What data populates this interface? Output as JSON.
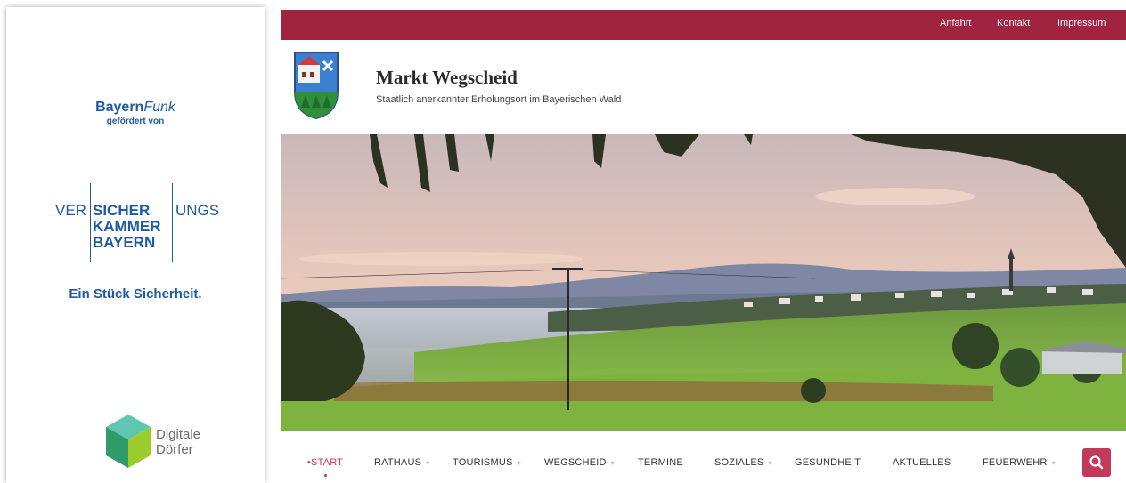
{
  "sponsor": {
    "bayernfunk_main": "Bayern",
    "bayernfunk_italic": "Funk",
    "bayernfunk_sub": "gefördert von",
    "vkb_ver": "VER",
    "vkb_sicher": "SICHER",
    "vkb_ungs": "UNGS",
    "vkb_kammer": "KAMMER",
    "vkb_bayern": "BAYERN",
    "slogan": "Ein Stück Sicherheit.",
    "dd_line1": "Digitale",
    "dd_line2": "Dörfer"
  },
  "topbar": {
    "links": [
      "Anfahrt",
      "Kontakt",
      "Impressum"
    ]
  },
  "header": {
    "title": "Markt Wegscheid",
    "subtitle": "Staatlich anerkannter Erholungsort im Bayerischen Wald"
  },
  "nav": {
    "items": [
      {
        "label": "•START",
        "active": true,
        "dropdown": false
      },
      {
        "label": "RATHAUS",
        "dropdown": true
      },
      {
        "label": "TOURISMUS",
        "dropdown": true
      },
      {
        "label": "WEGSCHEID",
        "dropdown": true
      },
      {
        "label": "TERMINE",
        "dropdown": false
      },
      {
        "label": "SOZIALES",
        "dropdown": true
      },
      {
        "label": "GESUNDHEIT",
        "dropdown": false
      },
      {
        "label": "AKTUELLES",
        "dropdown": false
      },
      {
        "label": "FEUERWEHR",
        "dropdown": true
      }
    ],
    "caret": "▾"
  },
  "colors": {
    "brand": "#a0233f",
    "accent": "#c23a5a",
    "sponsor_blue": "#1f5aa6"
  },
  "icons": {
    "search": "search-icon",
    "crest": "coat-of-arms-icon",
    "digitale_doerfer": "cube-logo-icon"
  }
}
